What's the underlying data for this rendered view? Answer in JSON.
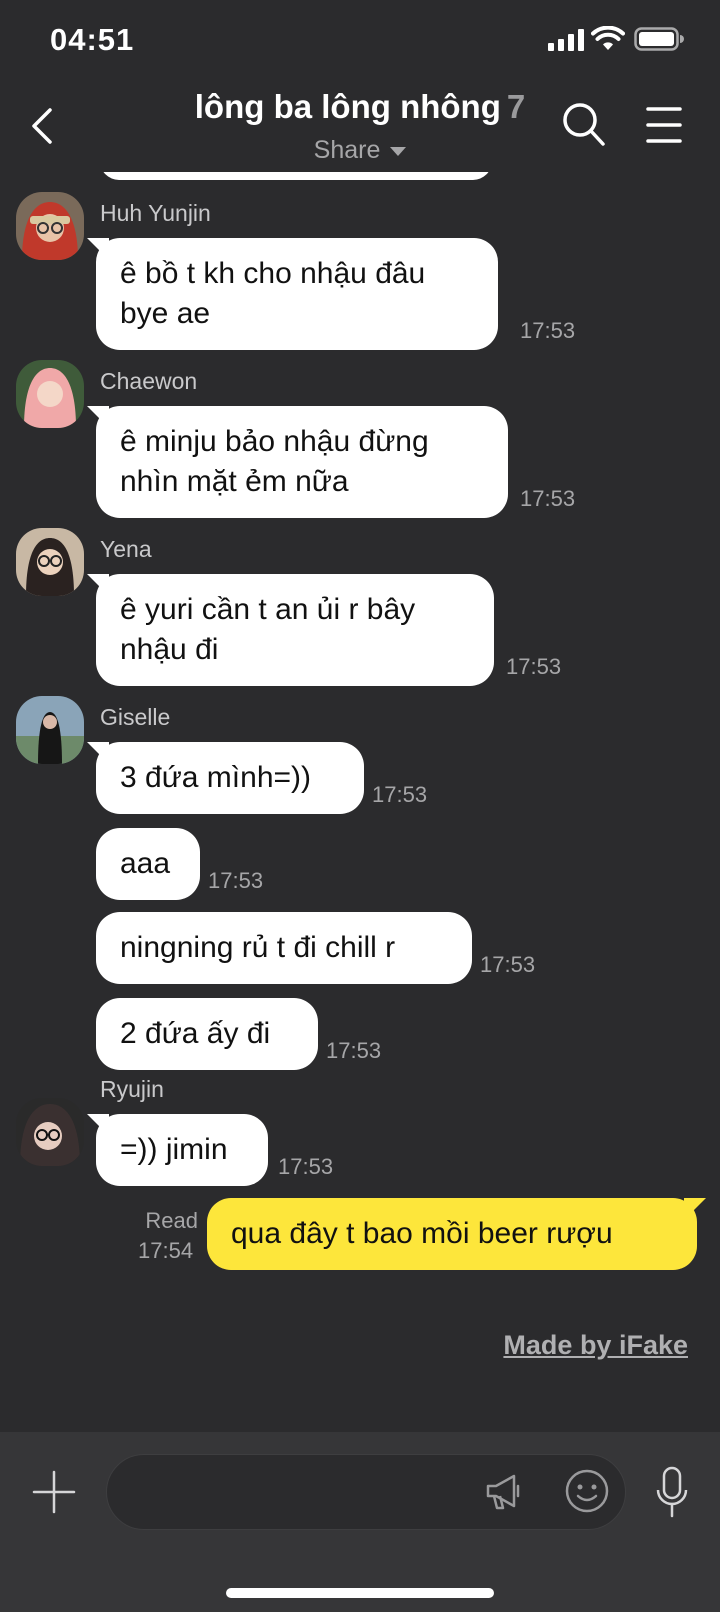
{
  "status_bar": {
    "time": "04:51"
  },
  "header": {
    "title": "lông ba lông nhông",
    "member_count": "7",
    "share_label": "Share"
  },
  "messages": [
    {
      "sender": "Huh Yunjin",
      "lines": [
        "ê bồ t kh cho nhậu đâu",
        "bye ae"
      ],
      "time": "17:53"
    },
    {
      "sender": "Chaewon",
      "lines": [
        "ê minju bảo nhậu đừng",
        "nhìn mặt ẻm nữa"
      ],
      "time": "17:53"
    },
    {
      "sender": "Yena",
      "lines": [
        "ê yuri cần t an ủi r bây",
        "nhậu đi"
      ],
      "time": "17:53"
    },
    {
      "sender": "Giselle",
      "lines": [
        "3 đứa mình=))"
      ],
      "time": "17:53"
    },
    {
      "lines": [
        "aaa"
      ],
      "time": "17:53"
    },
    {
      "lines": [
        "ningning rủ t đi chill r"
      ],
      "time": "17:53"
    },
    {
      "lines": [
        "2 đứa ấy đi"
      ],
      "time": "17:53"
    },
    {
      "sender": "Ryujin",
      "lines": [
        "=)) jimin"
      ],
      "time": "17:53"
    }
  ],
  "my_message": {
    "read_label": "Read",
    "time": "17:54",
    "text": "qua đây t bao mồi beer rượu"
  },
  "watermark": "Made by iFake",
  "input": {
    "placeholder": ""
  },
  "colors": {
    "background": "#2b2b2d",
    "my_bubble": "#fde63b",
    "other_bubble": "#ffffff",
    "input_bar": "#363638"
  }
}
